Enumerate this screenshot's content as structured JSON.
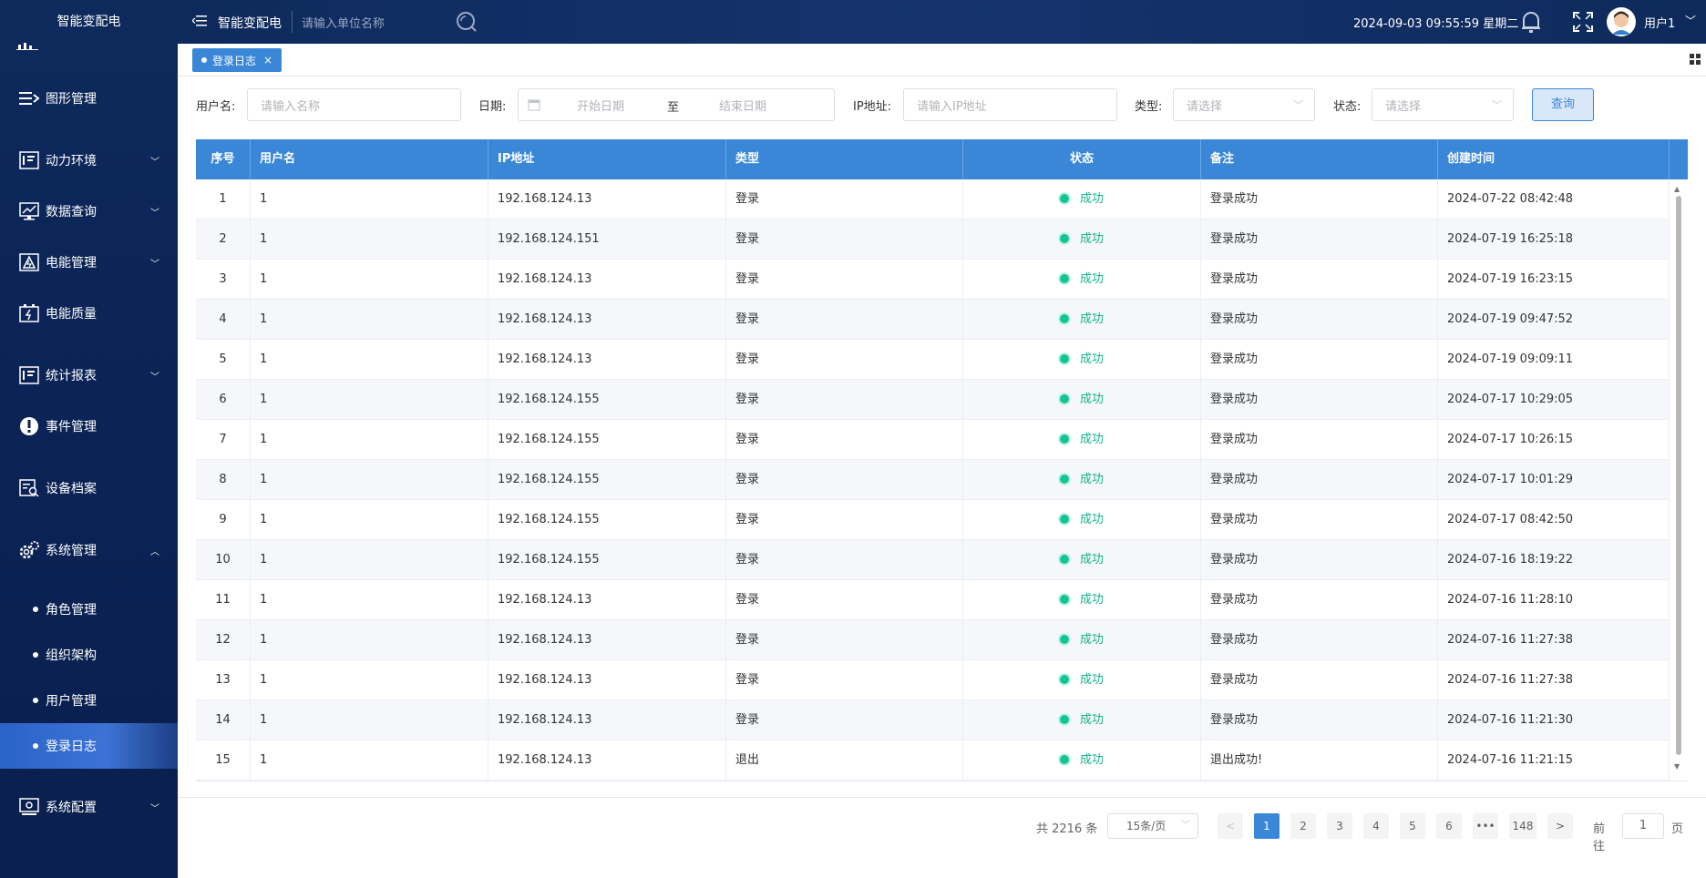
{
  "app": {
    "brand": "智能变配电",
    "title": "智能变配电",
    "unit_search_placeholder": "请输入单位名称",
    "datetime": "2024-09-03 09:55:59 星期二",
    "user": "用户1"
  },
  "sidebar": {
    "items": [
      {
        "label": "图形管理",
        "icon": "diagram-icon"
      },
      {
        "label": "动力环境",
        "icon": "monitor-icon"
      },
      {
        "label": "数据查询",
        "icon": "chart-screen-icon"
      },
      {
        "label": "电能管理",
        "icon": "power-icon"
      },
      {
        "label": "电能质量",
        "icon": "battery-icon"
      },
      {
        "label": "统计报表",
        "icon": "report-icon"
      },
      {
        "label": "事件管理",
        "icon": "alert-icon"
      },
      {
        "label": "设备档案",
        "icon": "device-search-icon"
      },
      {
        "label": "系统管理",
        "icon": "gear-icon"
      },
      {
        "label": "系统配置",
        "icon": "config-icon"
      }
    ],
    "sub_items": [
      "角色管理",
      "组织架构",
      "用户管理",
      "登录日志"
    ]
  },
  "tabs": [
    {
      "label": "登录日志",
      "close": "×"
    }
  ],
  "filters": {
    "username_label": "用户名:",
    "username_placeholder": "请输入名称",
    "date_label": "日期:",
    "date_start": "开始日期",
    "date_sep": "至",
    "date_end": "结束日期",
    "ip_label": "IP地址:",
    "ip_placeholder": "请输入IP地址",
    "type_label": "类型:",
    "type_placeholder": "请选择",
    "status_label": "状态:",
    "status_placeholder": "请选择",
    "query_button": "查询"
  },
  "table": {
    "columns": [
      "序号",
      "用户名",
      "IP地址",
      "类型",
      "状态",
      "备注",
      "创建时间"
    ],
    "rows": [
      [
        "1",
        "1",
        "192.168.124.13",
        "登录",
        "成功",
        "登录成功",
        "2024-07-22 08:42:48"
      ],
      [
        "2",
        "1",
        "192.168.124.151",
        "登录",
        "成功",
        "登录成功",
        "2024-07-19 16:25:18"
      ],
      [
        "3",
        "1",
        "192.168.124.13",
        "登录",
        "成功",
        "登录成功",
        "2024-07-19 16:23:15"
      ],
      [
        "4",
        "1",
        "192.168.124.13",
        "登录",
        "成功",
        "登录成功",
        "2024-07-19 09:47:52"
      ],
      [
        "5",
        "1",
        "192.168.124.13",
        "登录",
        "成功",
        "登录成功",
        "2024-07-19 09:09:11"
      ],
      [
        "6",
        "1",
        "192.168.124.155",
        "登录",
        "成功",
        "登录成功",
        "2024-07-17 10:29:05"
      ],
      [
        "7",
        "1",
        "192.168.124.155",
        "登录",
        "成功",
        "登录成功",
        "2024-07-17 10:26:15"
      ],
      [
        "8",
        "1",
        "192.168.124.155",
        "登录",
        "成功",
        "登录成功",
        "2024-07-17 10:01:29"
      ],
      [
        "9",
        "1",
        "192.168.124.155",
        "登录",
        "成功",
        "登录成功",
        "2024-07-17 08:42:50"
      ],
      [
        "10",
        "1",
        "192.168.124.155",
        "登录",
        "成功",
        "登录成功",
        "2024-07-16 18:19:22"
      ],
      [
        "11",
        "1",
        "192.168.124.13",
        "登录",
        "成功",
        "登录成功",
        "2024-07-16 11:28:10"
      ],
      [
        "12",
        "1",
        "192.168.124.13",
        "登录",
        "成功",
        "登录成功",
        "2024-07-16 11:27:38"
      ],
      [
        "13",
        "1",
        "192.168.124.13",
        "登录",
        "成功",
        "登录成功",
        "2024-07-16 11:27:38"
      ],
      [
        "14",
        "1",
        "192.168.124.13",
        "登录",
        "成功",
        "登录成功",
        "2024-07-16 11:21:30"
      ],
      [
        "15",
        "1",
        "192.168.124.13",
        "退出",
        "成功",
        "退出成功!",
        "2024-07-16 11:21:15"
      ]
    ]
  },
  "pagination": {
    "total": "共 2216 条",
    "page_size": "15条/页",
    "pages": [
      "1",
      "2",
      "3",
      "4",
      "5",
      "6",
      "•••",
      "148"
    ],
    "current": "1",
    "goto_prefix": "前往",
    "goto_value": "1",
    "goto_suffix": "页"
  },
  "colors": {
    "header": "#3a87d8",
    "success": "#13b389",
    "sidebar": "#0b2356"
  }
}
